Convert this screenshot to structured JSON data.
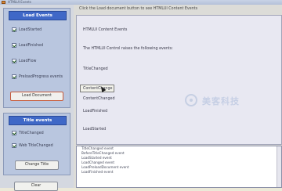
{
  "window": {
    "title": "HTMLUI Events"
  },
  "load_events": {
    "header": "Load Events",
    "checkboxes": [
      {
        "label": "LoadStarted",
        "checked": true
      },
      {
        "label": "LoadFinished",
        "checked": true
      },
      {
        "label": "LoadFlow",
        "checked": true
      },
      {
        "label": "PreloadProgress events",
        "checked": true
      }
    ],
    "button": "Load Document"
  },
  "title_events": {
    "header": "Title events",
    "checkboxes": [
      {
        "label": "TitleChanged",
        "checked": true
      },
      {
        "label": "Web TitleChanged",
        "checked": true
      }
    ],
    "button": "Change Title"
  },
  "bottom_button": "Clear",
  "info_text": "Click the Load document button to see HTMLUI Content Events",
  "content": {
    "lines": [
      "HTMLUI Content Events",
      "The HTMLUI Control raises the following events:",
      "TitleChanged",
      "ContentChange",
      "ContentChanged",
      "LoadFinished",
      "LoadStarted"
    ]
  },
  "watermark": {
    "text": "美客科技"
  },
  "log": [
    "TitleChanged event",
    "BeforeTitleChanged event",
    "LoadStarted event",
    "LoadChanged event",
    "LoadPreloadDocument event",
    "LoadFinished event"
  ]
}
